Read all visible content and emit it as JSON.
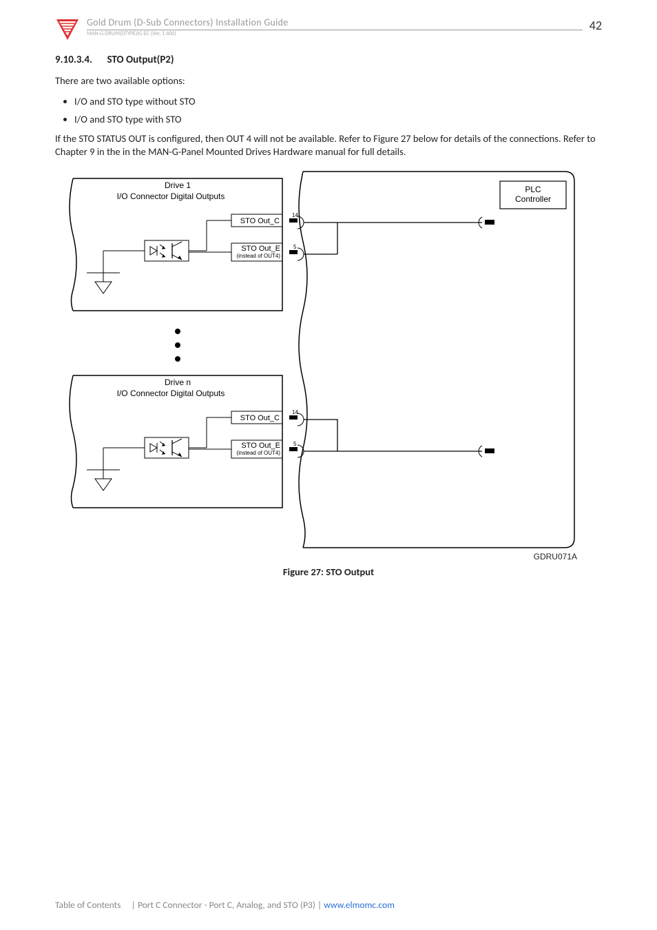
{
  "header": {
    "doc_title": "Gold Drum (D-Sub Connectors) Installation Guide",
    "doc_version": "MAN-G-DRUM(DTYPE)IG-EC (Ver. 1.400)",
    "page_number": "42"
  },
  "section": {
    "number": "9.10.3.4.",
    "title": "STO Output(P2)"
  },
  "body": {
    "intro": "There are two available options:",
    "bullets": [
      "I/O and STO type without STO",
      "I/O and STO type with STO"
    ],
    "para": "If the STO STATUS OUT is configured, then OUT 4 will not be available. Refer to Figure 27 below for details of the connections. Refer to Chapter 9 in the in the MAN-G-Panel Mounted Drives Hardware manual for full details."
  },
  "figure": {
    "drive1_title": "Drive 1",
    "io_label": "I/O Connector Digital Outputs",
    "sto_out_c": "STO Out_C",
    "sto_out_e": "STO Out_E",
    "sto_out_e_sub": "(instead of OUT4)",
    "pin14": "14",
    "pin5": "5",
    "driven_title": "Drive n",
    "plc_line1": "PLC",
    "plc_line2": "Controller",
    "code": "GDRU071A",
    "caption": "Figure 27: STO Output"
  },
  "footer": {
    "toc": "Table of Contents",
    "sep1": "|",
    "section_link": "Port C Connector - Port C, Analog, and STO (P3)",
    "sep2": "|",
    "url": "www.elmomc.com"
  }
}
